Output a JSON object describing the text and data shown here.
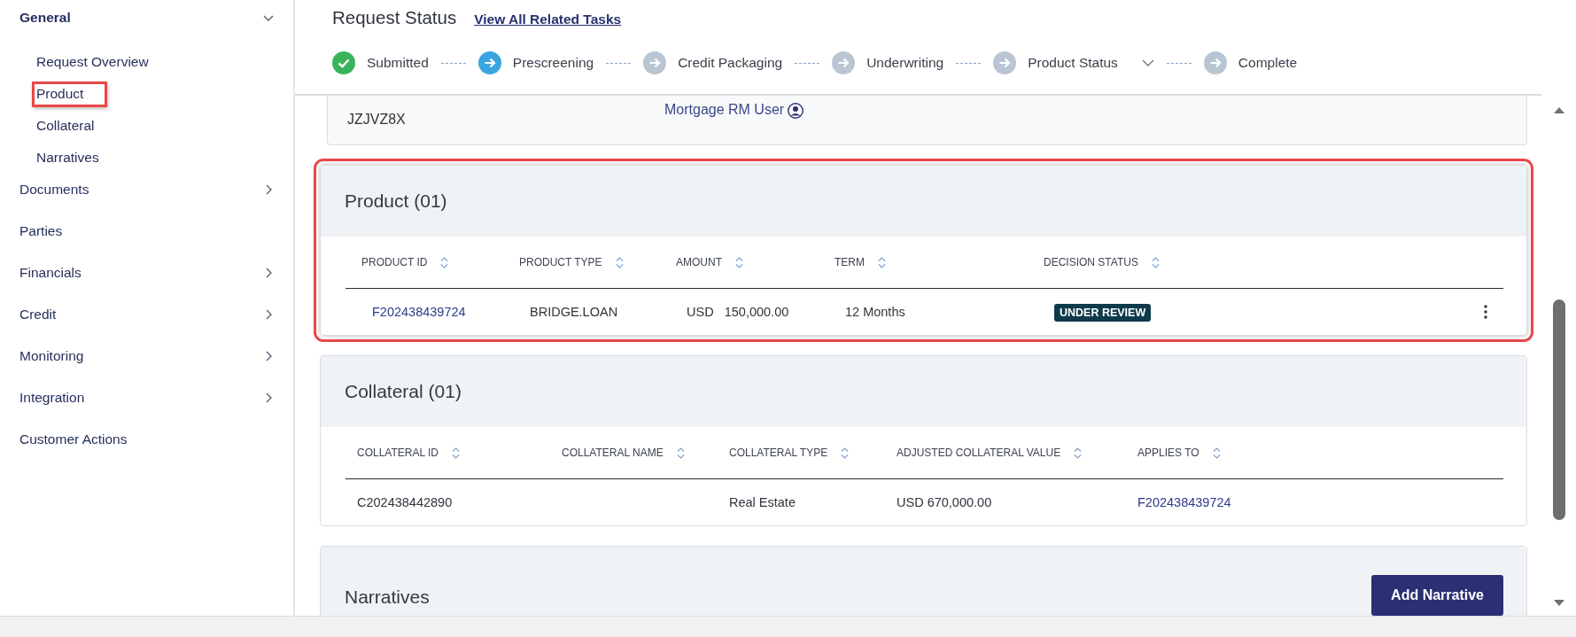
{
  "sidebar": {
    "items": [
      {
        "label": "General",
        "kind": "group",
        "expanded": true,
        "children": [
          {
            "label": "Request Overview",
            "highlighted": false
          },
          {
            "label": "Product",
            "highlighted": true
          },
          {
            "label": "Collateral",
            "highlighted": false
          },
          {
            "label": "Narratives",
            "highlighted": false
          }
        ]
      },
      {
        "label": "Documents",
        "kind": "group",
        "expanded": false
      },
      {
        "label": "Parties",
        "kind": "link"
      },
      {
        "label": "Financials",
        "kind": "group",
        "expanded": false
      },
      {
        "label": "Credit",
        "kind": "group",
        "expanded": false
      },
      {
        "label": "Monitoring",
        "kind": "group",
        "expanded": false
      },
      {
        "label": "Integration",
        "kind": "group",
        "expanded": false
      },
      {
        "label": "Customer Actions",
        "kind": "link"
      }
    ]
  },
  "header": {
    "title": "Request Status",
    "link": "View All Related Tasks",
    "steps": [
      {
        "label": "Submitted",
        "completed": true,
        "selected": false,
        "dropdown": false
      },
      {
        "label": "Prescreening",
        "completed": false,
        "selected": true,
        "dropdown": false
      },
      {
        "label": "Credit Packaging",
        "completed": false,
        "selected": false,
        "dropdown": false
      },
      {
        "label": "Underwriting",
        "completed": false,
        "selected": false,
        "dropdown": false
      },
      {
        "label": "Product Status",
        "completed": false,
        "selected": false,
        "dropdown": true
      },
      {
        "label": "Complete",
        "completed": false,
        "selected": false,
        "dropdown": false
      }
    ]
  },
  "overview_card": {
    "request_id": "JZJVZ8X",
    "user": "Mortgage RM User"
  },
  "product": {
    "title": "Product (01)",
    "highlighted": true,
    "columns": [
      "PRODUCT ID",
      "PRODUCT TYPE",
      "AMOUNT",
      "TERM",
      "DECISION STATUS"
    ],
    "rows": [
      {
        "menu": true,
        "cells": [
          {
            "kind": "link",
            "text": "F202438439724"
          },
          {
            "kind": "text",
            "text": "BRIDGE.LOAN"
          },
          {
            "kind": "amount",
            "currency": "USD",
            "text": "150,000.00"
          },
          {
            "kind": "text",
            "text": "12 Months"
          },
          {
            "kind": "badge",
            "text": "UNDER REVIEW"
          }
        ]
      }
    ]
  },
  "collateral": {
    "title": "Collateral (01)",
    "highlighted": false,
    "columns": [
      "COLLATERAL ID",
      "COLLATERAL NAME",
      "COLLATERAL TYPE",
      "ADJUSTED COLLATERAL VALUE",
      "APPLIES TO"
    ],
    "rows": [
      {
        "menu": false,
        "cells": [
          {
            "kind": "text",
            "text": "C202438442890"
          },
          {
            "kind": "empty"
          },
          {
            "kind": "text",
            "text": "Real Estate"
          },
          {
            "kind": "text",
            "text": "USD 670,000.00"
          },
          {
            "kind": "link",
            "text": "F202438439724"
          }
        ]
      }
    ]
  },
  "narratives": {
    "title": "Narratives",
    "button": "Add Narrative"
  }
}
